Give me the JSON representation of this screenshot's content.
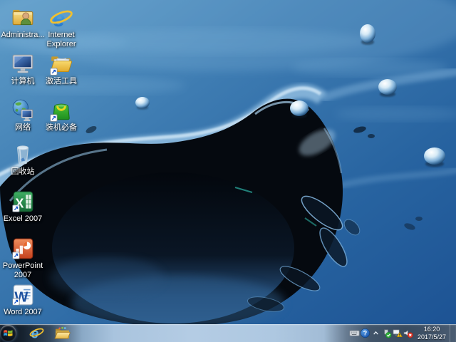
{
  "desktop": {
    "icons": [
      {
        "id": "administrator",
        "label": "Administra..."
      },
      {
        "id": "internet-explorer",
        "label": "Internet Explorer"
      },
      {
        "id": "computer",
        "label": "计算机"
      },
      {
        "id": "activation-tools",
        "label": "激活工具"
      },
      {
        "id": "network",
        "label": "网络"
      },
      {
        "id": "essential-software",
        "label": "装机必备"
      },
      {
        "id": "recycle-bin",
        "label": "回收站"
      },
      {
        "id": "excel",
        "label": "Excel 2007"
      },
      {
        "id": "powerpoint",
        "label": "PowerPoint 2007"
      },
      {
        "id": "word",
        "label": "Word 2007"
      }
    ]
  },
  "glyphs": {
    "ie_logo": "e",
    "excel_letter": "X",
    "word_letter": "W",
    "help_mark": "?"
  },
  "taskbar": {
    "pinned_icons": [
      "internet-explorer-icon",
      "windows-explorer-folder-icon"
    ],
    "tray_icons": [
      "keyboard-input-icon",
      "help-question-icon",
      "show-hidden-icons-chevron",
      "utility-green-check-icon",
      "network-limited-warning-icon",
      "volume-muted-icon"
    ],
    "clock": {
      "time": "16:20",
      "date": "2017/5/27"
    }
  },
  "colors": {
    "wallpaper_top": "#5e9cc8",
    "wallpaper_bottom": "#1d5394",
    "splash_dark": "#05090f",
    "taskbar_glass_light": "#b4cce4",
    "taskbar_glass_dark": "#16222f",
    "warning_yellow": "#f7c61e",
    "mute_red": "#dd3526",
    "check_green": "#2fae3c"
  }
}
